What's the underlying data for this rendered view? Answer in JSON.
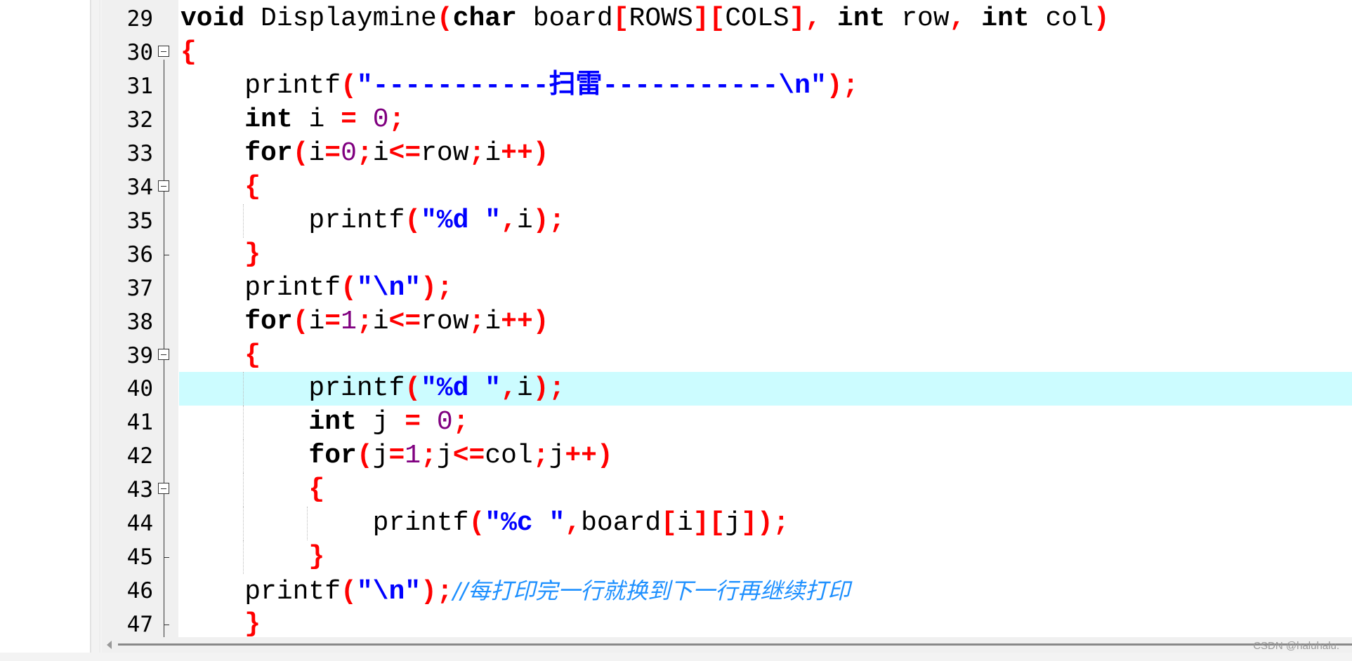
{
  "editor": {
    "highlighted_line": 40,
    "colors": {
      "keyword": "#000000",
      "punctuation": "#ff0000",
      "number": "#800080",
      "string": "#0000ff",
      "comment": "#1e90ff",
      "highlight": "#ccfcff"
    },
    "lines": [
      {
        "num": "29",
        "tokens": [
          [
            "k",
            "void"
          ],
          [
            "i",
            " Displaymine"
          ],
          [
            "p",
            "("
          ],
          [
            "k",
            "char"
          ],
          [
            "i",
            " board"
          ],
          [
            "p",
            "["
          ],
          [
            "i",
            "ROWS"
          ],
          [
            "p",
            "]["
          ],
          [
            "i",
            "COLS"
          ],
          [
            "p",
            "],"
          ],
          [
            "i",
            " "
          ],
          [
            "k",
            "int"
          ],
          [
            "i",
            " row"
          ],
          [
            "p",
            ","
          ],
          [
            "i",
            " "
          ],
          [
            "k",
            "int"
          ],
          [
            "i",
            " col"
          ],
          [
            "p",
            ")"
          ]
        ]
      },
      {
        "num": "30",
        "fold": "open",
        "tokens": [
          [
            "p",
            "{"
          ]
        ]
      },
      {
        "num": "31",
        "tokens": [
          [
            "i",
            "    printf"
          ],
          [
            "p",
            "("
          ],
          [
            "s",
            "\"-----------扫雷-----------\\n\""
          ],
          [
            "p",
            ");"
          ]
        ]
      },
      {
        "num": "32",
        "tokens": [
          [
            "k",
            "    int"
          ],
          [
            "i",
            " i "
          ],
          [
            "p",
            "="
          ],
          [
            "i",
            " "
          ],
          [
            "n",
            "0"
          ],
          [
            "p",
            ";"
          ]
        ]
      },
      {
        "num": "33",
        "tokens": [
          [
            "k",
            "    for"
          ],
          [
            "p",
            "("
          ],
          [
            "i",
            "i"
          ],
          [
            "p",
            "="
          ],
          [
            "n",
            "0"
          ],
          [
            "p",
            ";"
          ],
          [
            "i",
            "i"
          ],
          [
            "p",
            "<="
          ],
          [
            "i",
            "row"
          ],
          [
            "p",
            ";"
          ],
          [
            "i",
            "i"
          ],
          [
            "p",
            "++)"
          ]
        ]
      },
      {
        "num": "34",
        "fold": "open",
        "tokens": [
          [
            "p",
            "    {"
          ]
        ]
      },
      {
        "num": "35",
        "tokens": [
          [
            "i",
            "        printf"
          ],
          [
            "p",
            "("
          ],
          [
            "s",
            "\"%d \""
          ],
          [
            "p",
            ","
          ],
          [
            "i",
            "i"
          ],
          [
            "p",
            ");"
          ]
        ]
      },
      {
        "num": "36",
        "fold": "end",
        "tokens": [
          [
            "p",
            "    }"
          ]
        ]
      },
      {
        "num": "37",
        "tokens": [
          [
            "i",
            "    printf"
          ],
          [
            "p",
            "("
          ],
          [
            "s",
            "\"\\n\""
          ],
          [
            "p",
            ");"
          ]
        ]
      },
      {
        "num": "38",
        "tokens": [
          [
            "k",
            "    for"
          ],
          [
            "p",
            "("
          ],
          [
            "i",
            "i"
          ],
          [
            "p",
            "="
          ],
          [
            "n",
            "1"
          ],
          [
            "p",
            ";"
          ],
          [
            "i",
            "i"
          ],
          [
            "p",
            "<="
          ],
          [
            "i",
            "row"
          ],
          [
            "p",
            ";"
          ],
          [
            "i",
            "i"
          ],
          [
            "p",
            "++)"
          ]
        ]
      },
      {
        "num": "39",
        "fold": "open",
        "tokens": [
          [
            "p",
            "    {"
          ]
        ]
      },
      {
        "num": "40",
        "tokens": [
          [
            "i",
            "        printf"
          ],
          [
            "p",
            "("
          ],
          [
            "s",
            "\"%d \""
          ],
          [
            "p",
            ","
          ],
          [
            "i",
            "i"
          ],
          [
            "p",
            ");"
          ]
        ]
      },
      {
        "num": "41",
        "tokens": [
          [
            "k",
            "        int"
          ],
          [
            "i",
            " j "
          ],
          [
            "p",
            "="
          ],
          [
            "i",
            " "
          ],
          [
            "n",
            "0"
          ],
          [
            "p",
            ";"
          ]
        ]
      },
      {
        "num": "42",
        "tokens": [
          [
            "k",
            "        for"
          ],
          [
            "p",
            "("
          ],
          [
            "i",
            "j"
          ],
          [
            "p",
            "="
          ],
          [
            "n",
            "1"
          ],
          [
            "p",
            ";"
          ],
          [
            "i",
            "j"
          ],
          [
            "p",
            "<="
          ],
          [
            "i",
            "col"
          ],
          [
            "p",
            ";"
          ],
          [
            "i",
            "j"
          ],
          [
            "p",
            "++)"
          ]
        ]
      },
      {
        "num": "43",
        "fold": "open",
        "tokens": [
          [
            "p",
            "        {"
          ]
        ]
      },
      {
        "num": "44",
        "tokens": [
          [
            "i",
            "            printf"
          ],
          [
            "p",
            "("
          ],
          [
            "s",
            "\"%c \""
          ],
          [
            "p",
            ","
          ],
          [
            "i",
            "board"
          ],
          [
            "p",
            "["
          ],
          [
            "i",
            "i"
          ],
          [
            "p",
            "]["
          ],
          [
            "i",
            "j"
          ],
          [
            "p",
            "]);"
          ]
        ]
      },
      {
        "num": "45",
        "fold": "end",
        "tokens": [
          [
            "p",
            "        }"
          ]
        ]
      },
      {
        "num": "46",
        "tokens": [
          [
            "i",
            "    printf"
          ],
          [
            "p",
            "("
          ],
          [
            "s",
            "\"\\n\""
          ],
          [
            "p",
            ");"
          ],
          [
            "c",
            "//每打印完一行就换到下一行再继续打印"
          ]
        ]
      },
      {
        "num": "47",
        "fold": "end",
        "tokens": [
          [
            "p",
            "    }"
          ]
        ]
      }
    ]
  },
  "watermark": "CSDN @haluhalu."
}
